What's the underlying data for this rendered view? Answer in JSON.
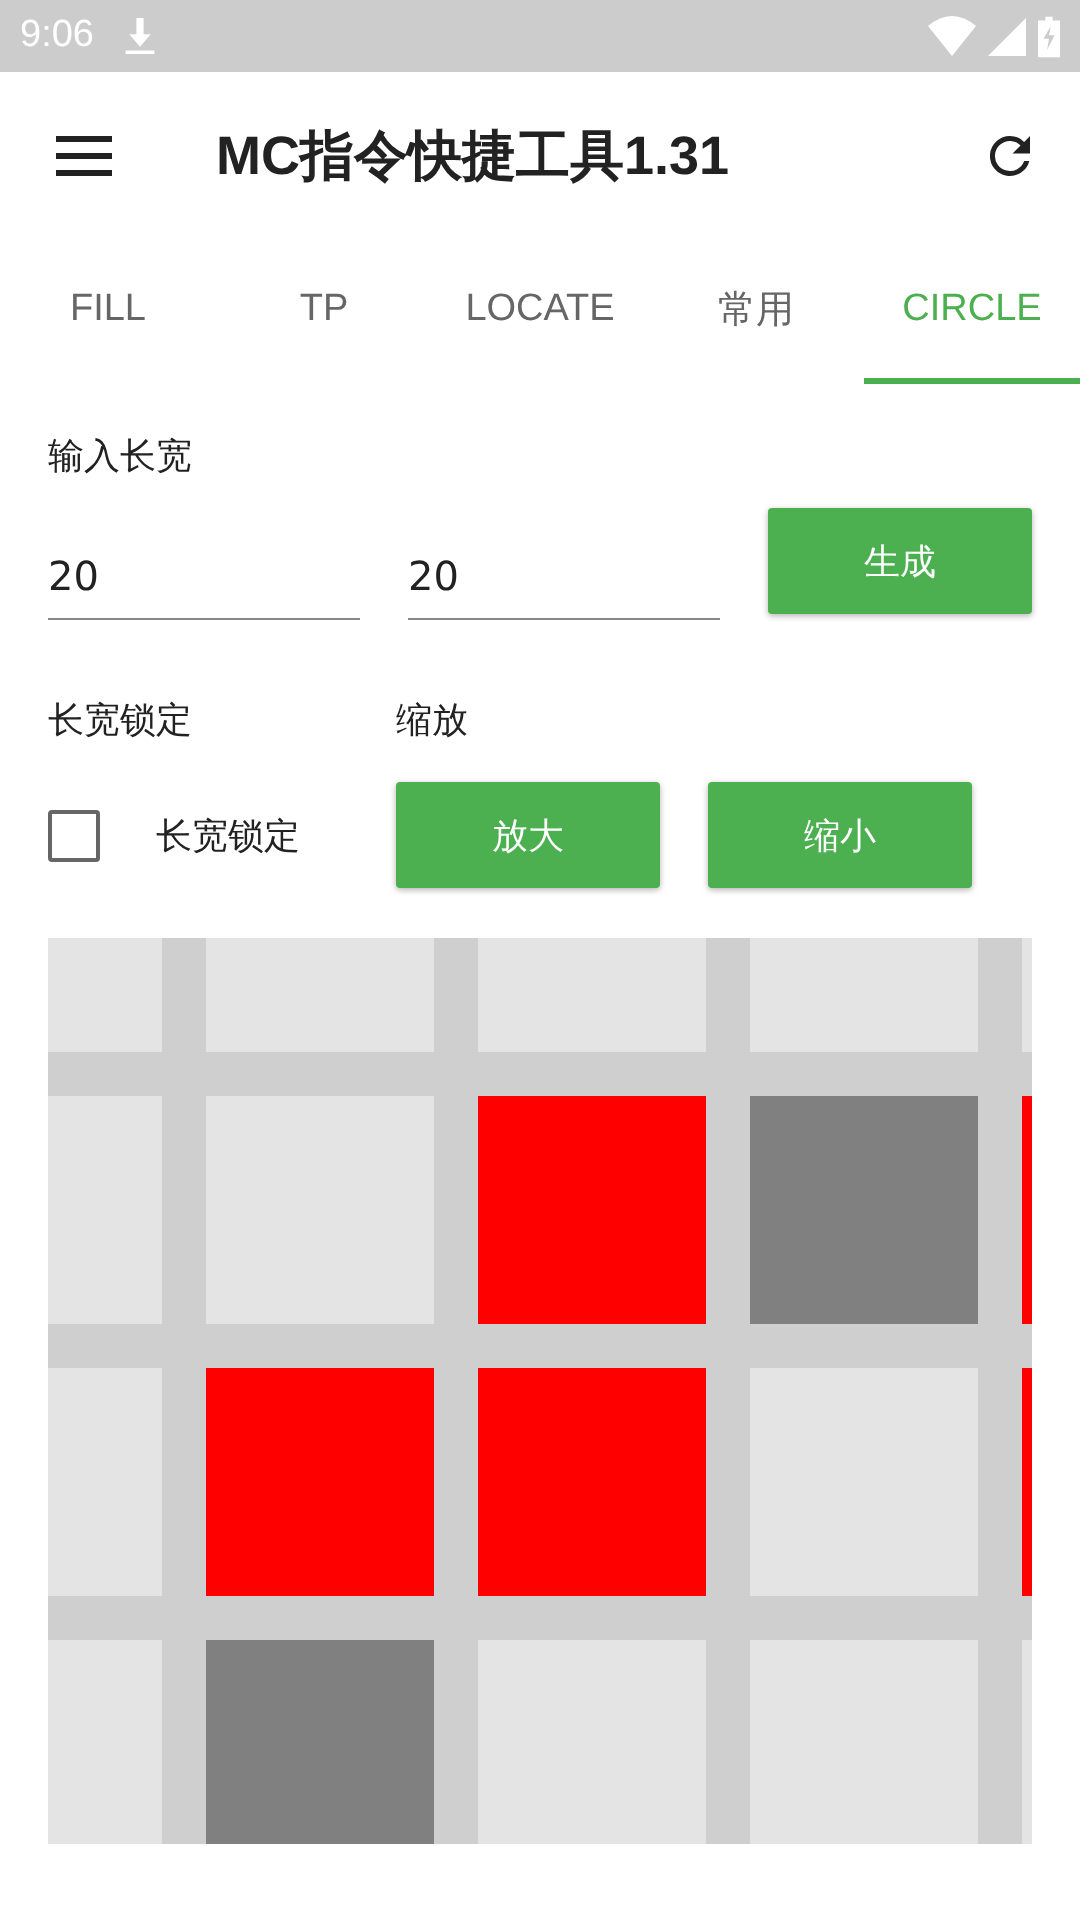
{
  "status_bar": {
    "time": "9:06"
  },
  "app_bar": {
    "title": "MC指令快捷工具1.31"
  },
  "tabs": [
    {
      "label": "FILL",
      "selected": false
    },
    {
      "label": "TP",
      "selected": false
    },
    {
      "label": "LOCATE",
      "selected": false
    },
    {
      "label": "常用",
      "selected": false
    },
    {
      "label": "CIRCLE",
      "selected": true
    }
  ],
  "size_section": {
    "label": "输入长宽",
    "width_value": "20",
    "height_value": "20",
    "generate_button": "生成"
  },
  "lock_section": {
    "label": "长宽锁定",
    "checkbox": {
      "label": "长宽锁定",
      "checked": false
    }
  },
  "zoom_section": {
    "label": "缩放",
    "buttons": [
      "放大",
      "缩小"
    ]
  },
  "grid": {
    "rows": [
      {
        "cells": [
          {
            "kind": "empty"
          },
          {
            "kind": "empty"
          },
          {
            "kind": "empty"
          },
          {
            "kind": "empty"
          },
          {
            "kind": "empty"
          }
        ]
      },
      {
        "cells": [
          {
            "kind": "empty"
          },
          {
            "kind": "empty"
          },
          {
            "kind": "filled"
          },
          {
            "kind": "marker"
          },
          {
            "kind": "filled"
          }
        ]
      },
      {
        "cells": [
          {
            "kind": "empty"
          },
          {
            "kind": "filled"
          },
          {
            "kind": "filled"
          },
          {
            "kind": "empty"
          },
          {
            "kind": "filled"
          }
        ]
      },
      {
        "cells": [
          {
            "kind": "empty"
          },
          {
            "kind": "marker"
          },
          {
            "kind": "empty"
          },
          {
            "kind": "empty"
          },
          {
            "kind": "empty"
          }
        ]
      }
    ]
  }
}
